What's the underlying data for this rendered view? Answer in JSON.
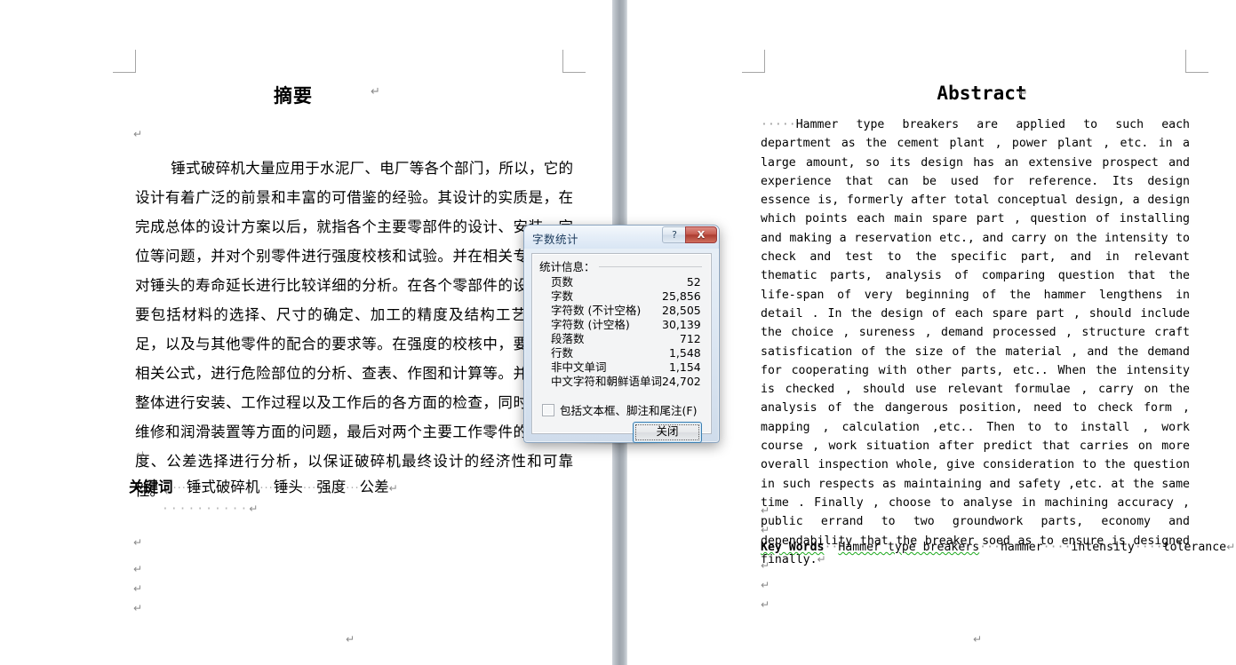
{
  "document": {
    "left_page": {
      "title": "摘要",
      "body": "锤式破碎机大量应用于水泥厂、电厂等各个部门，所以，它的设计有着广泛的前景和丰富的可借鉴的经验。其设计的实质是，在完成总体的设计方案以后，就指各个主要零部件的设计、安装、定位等问题，并对个别零件进行强度校核和试验。并在相关专题中，对锤头的寿命延长进行比较详细的分析。在各个零部件的设计中，要包括材料的选择、尺寸的确定、加工的精度及结构工艺性的满足，以及与其他零件的配合的要求等。在强度的校核中，要运用的相关公式，进行危险部位的分析、查表、作图和计算等。并随之对整体进行安装、工作过程以及工作后的各方面的检查，同时兼顾到维修和润滑装置等方面的问题，最后对两个主要工作零件的加工精度、公差选择进行分析，以保证破碎机最终设计的经济性和可靠性。",
      "keywords_label": "关键词",
      "keywords": [
        "锤式破碎机",
        "锤头",
        "强度",
        "公差"
      ]
    },
    "right_page": {
      "title": "Abstract",
      "body": "Hammer type breakers are applied to such each department as the cement plant , power plant , etc. in a large amount, so its design has an extensive prospect and experience that can be used for reference. Its design essence is, formerly after total conceptual design, a design which points each main spare part , question of installing and making a reservation etc., and carry on the intensity to check and test to the specific part, and in relevant thematic parts, analysis of comparing question that the life-span of very beginning of the hammer lengthens in detail . In the design of each spare part , should include the choice , sureness , demand processed , structure craft satisfication of the size of the material , and the demand for cooperating with other parts, etc.. When the intensity is checked , should use relevant formulae , carry on the analysis of the dangerous position, need to check form , mapping , calculation ,etc.. Then to to install , work course , work situation after predict that carries on more overall inspection whole, give consideration to the question in such respects as maintaining and safety ,etc. at the same time . Finally , choose to analyse in machining accuracy , public errand to two groundwork parts, economy and dependability that the breaker soed as to ensure is designed finally.",
      "keywords_label": "Key Words",
      "keywords": [
        "Hammer type breakers",
        "hammer",
        "intensity",
        "tolerance"
      ]
    },
    "pilcrow_glyph": "↵"
  },
  "dialog": {
    "title": "字数统计",
    "help_button": "?",
    "close_button_x": "X",
    "legend": "统计信息：",
    "stats": [
      {
        "label": "页数",
        "value": "52"
      },
      {
        "label": "字数",
        "value": "25,856"
      },
      {
        "label": "字符数 (不计空格)",
        "value": "28,505"
      },
      {
        "label": "字符数 (计空格)",
        "value": "30,139"
      },
      {
        "label": "段落数",
        "value": "712"
      },
      {
        "label": "行数",
        "value": "1,548"
      },
      {
        "label": "非中文单词",
        "value": "1,154"
      },
      {
        "label": "中文字符和朝鲜语单词",
        "value": "24,702"
      }
    ],
    "include_checkbox_label": "包括文本框、脚注和尾注(F)",
    "include_checked": false,
    "ok_button": "关闭"
  },
  "colors": {
    "accent_blue": "#3c7fb1",
    "close_red": "#ab3c30",
    "gutter_gray": "#9ea5ad",
    "crop_mark": "#a6a6a6",
    "pilcrow": "#8a8a8a",
    "spellcheck_red": "#e02020",
    "grammar_green": "#1ba81b"
  }
}
